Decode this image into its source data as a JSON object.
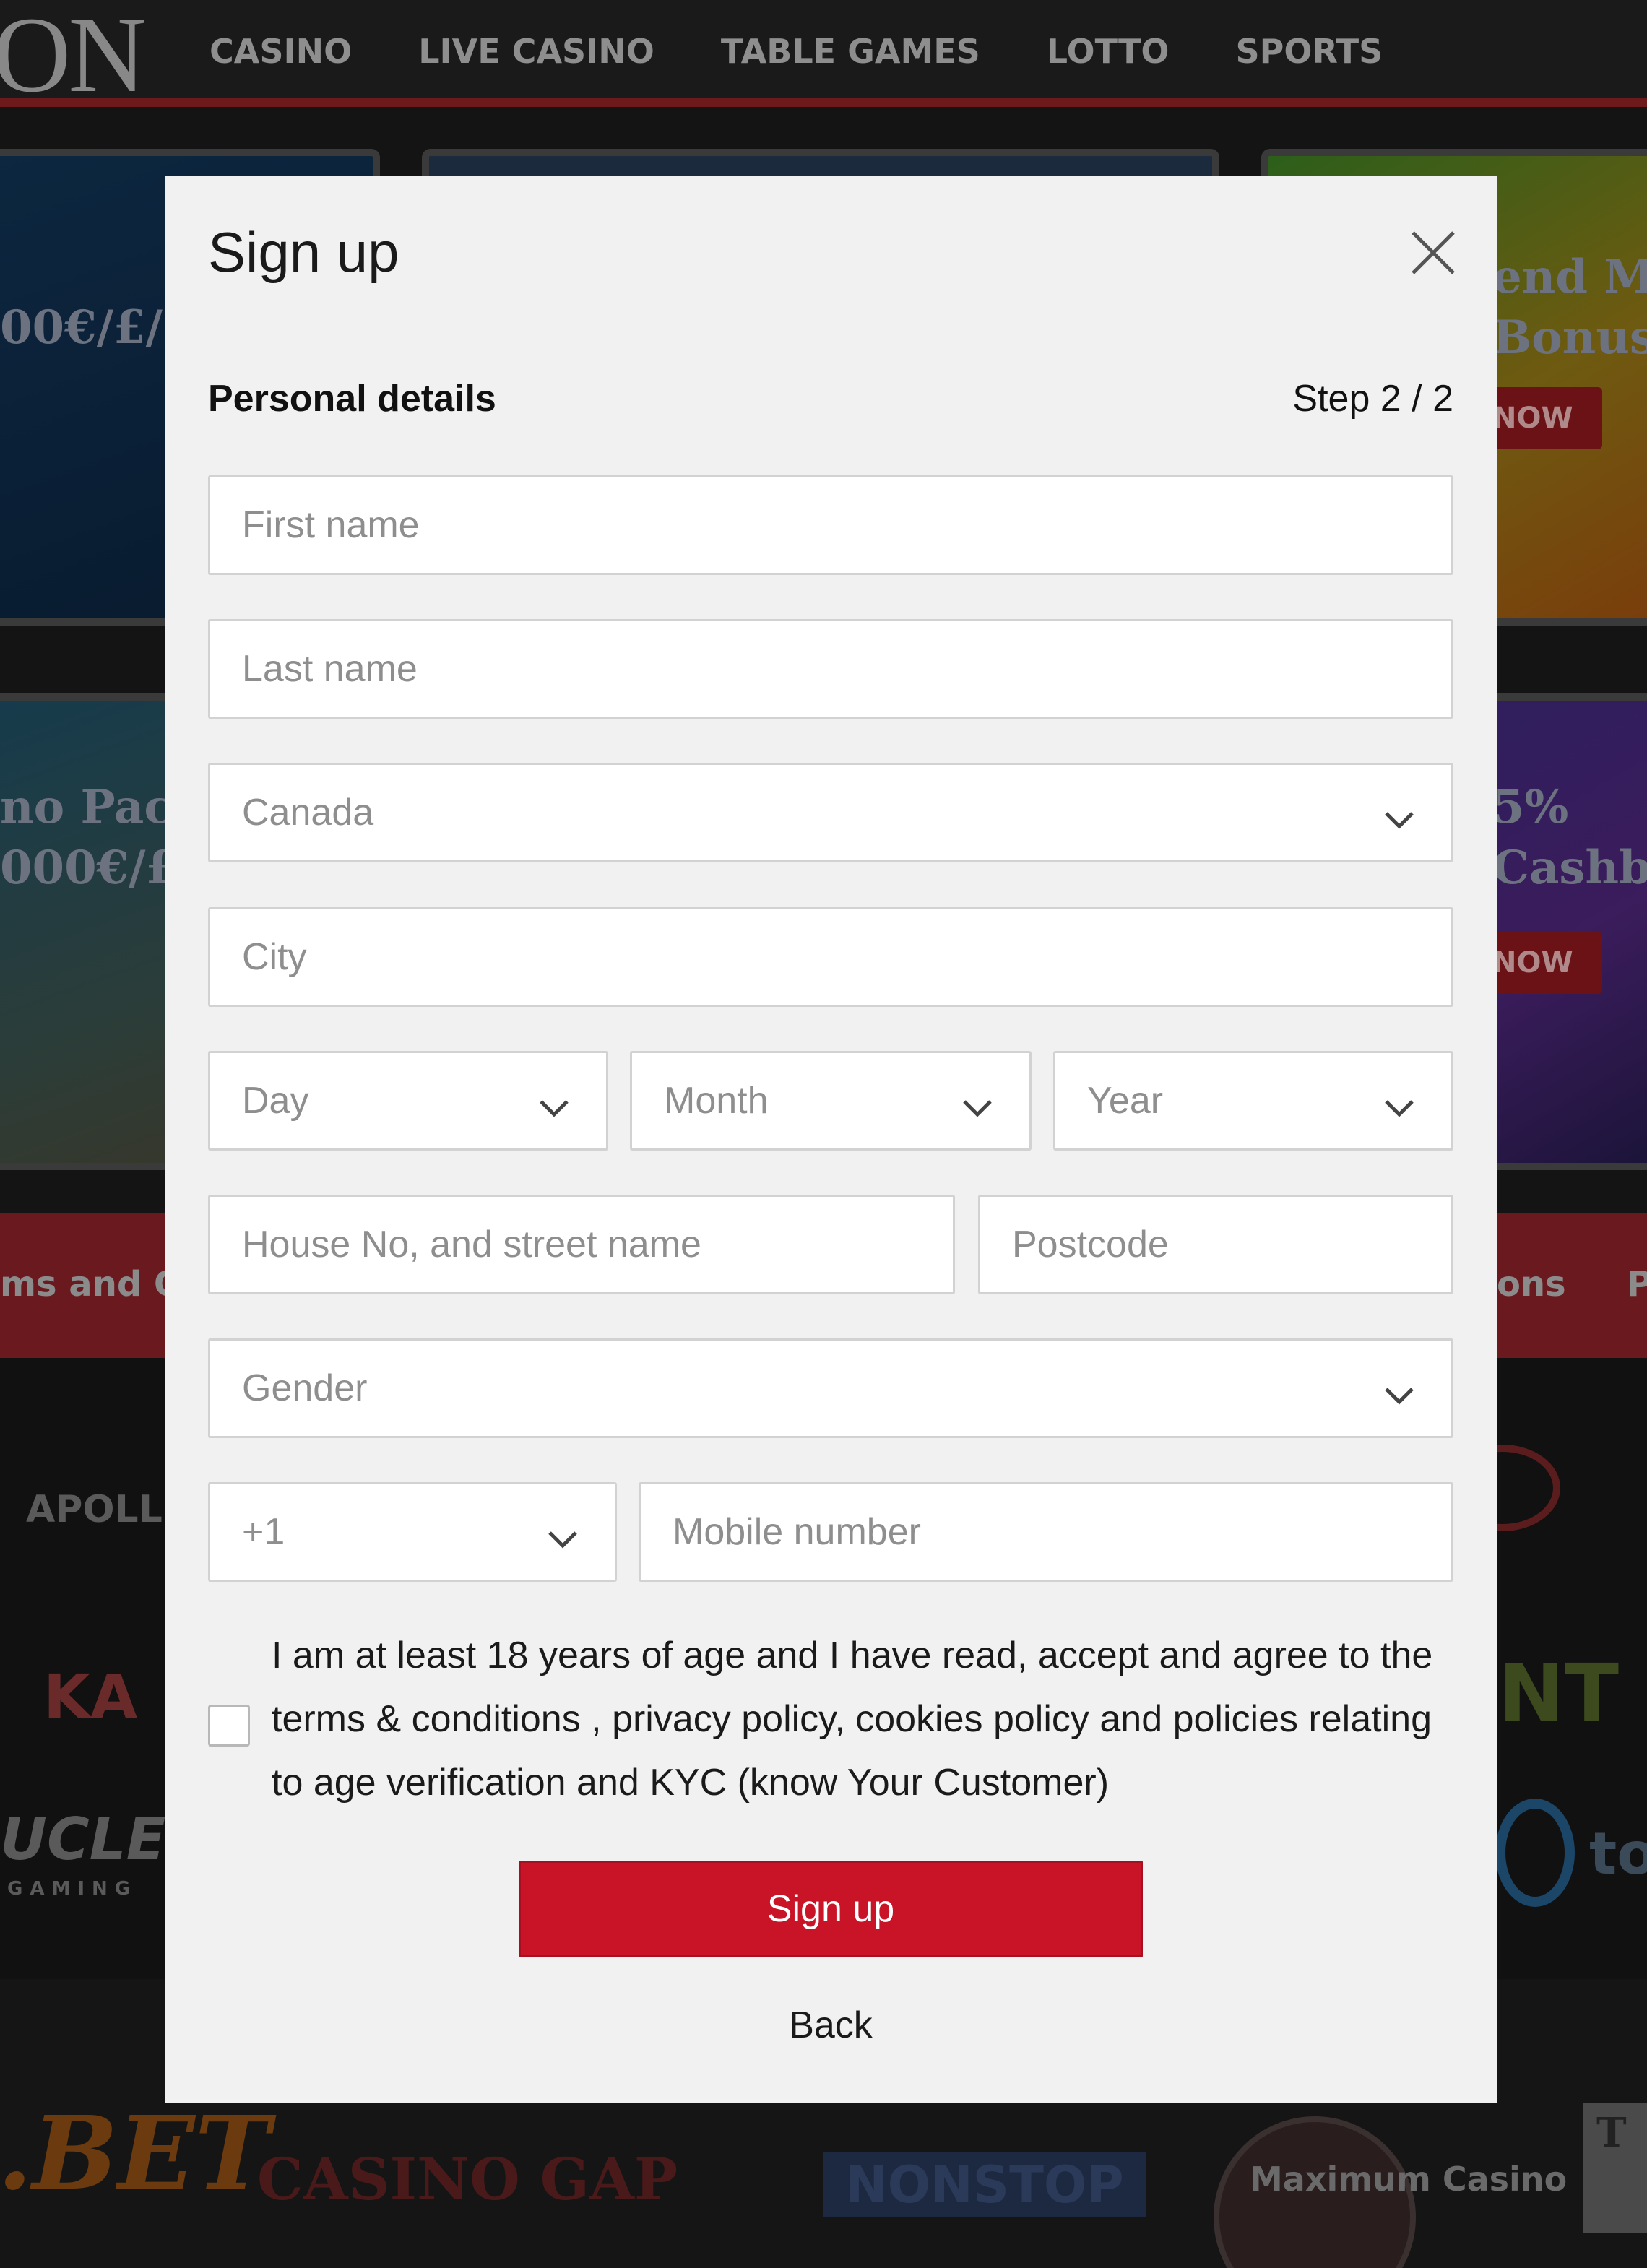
{
  "background": {
    "logo": "ON",
    "nav": [
      "CASINO",
      "LIVE CASINO",
      "TABLE GAMES",
      "LOTTO",
      "SPORTS"
    ],
    "banners": {
      "b1_text": "00€/£/",
      "b3_line1": "end Ma",
      "b3_line2": "Bonus",
      "b3_button": "NOW",
      "b4_line1": "no Pack",
      "b4_line2": "000€/£",
      "b5_line1": "5%",
      "b5_line2": "Cashba",
      "b5_button": "NOW"
    },
    "strip": {
      "left": "ms and Co",
      "right": "ons",
      "far_right": "P"
    },
    "providers": {
      "apollo": "APOLL",
      "nucleus": "UCLEU",
      "nucleus_sub": "GAMING",
      "ka": "KA",
      "nt": "NT",
      "to": "to"
    },
    "footer_logos": {
      "bet": ".BET",
      "casinogap": "CASINO GAP",
      "nonstop": "NONSTOP",
      "maximum": "Maximum Casino",
      "tc": "T"
    }
  },
  "modal": {
    "title": "Sign up",
    "section": "Personal details",
    "step": "Step 2 / 2",
    "fields": {
      "first_name": "First name",
      "last_name": "Last name",
      "country": "Canada",
      "city": "City",
      "day": "Day",
      "month": "Month",
      "year": "Year",
      "street": "House No, and street name",
      "postcode": "Postcode",
      "gender": "Gender",
      "dial_code": "+1",
      "mobile": "Mobile number"
    },
    "consent": "I am at least 18 years of age and I have read, accept and agree to the terms & conditions , privacy policy, cookies policy and policies relating to age verification and KYC (know Your Customer)",
    "submit": "Sign up",
    "back": "Back",
    "colors": {
      "accent": "#c91428",
      "panel": "#f1f1f1",
      "overlay": "#141414"
    }
  }
}
